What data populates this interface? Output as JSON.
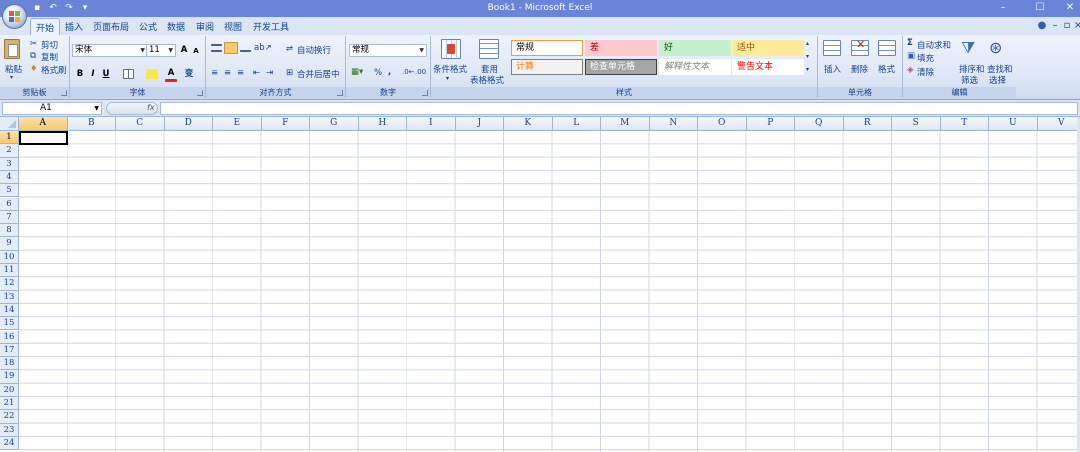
{
  "app": {
    "title": "Book1 - Microsoft Excel"
  },
  "qat": {
    "icons": [
      "save-icon",
      "undo-icon",
      "redo-icon",
      "customize-icon"
    ]
  },
  "tabs": [
    "开始",
    "插入",
    "页面布局",
    "公式",
    "数据",
    "审阅",
    "视图",
    "开发工具"
  ],
  "active_tab": "开始",
  "ribbon": {
    "clipboard": {
      "label": "剪贴板",
      "paste": "粘贴",
      "cut": "剪切",
      "copy": "复制",
      "format_painter": "格式刷"
    },
    "font": {
      "label": "字体",
      "font_name": "宋体",
      "font_size": "11",
      "bold": "B",
      "italic": "I",
      "underline": "U",
      "font_color_letter": "A",
      "phonetic": "变"
    },
    "alignment": {
      "label": "对齐方式",
      "wrap_text": "自动换行",
      "merge_center": "合并后居中"
    },
    "number": {
      "label": "数字",
      "format": "常规",
      "percent": "%",
      "comma": ","
    },
    "styles": {
      "label": "样式",
      "conditional_formatting": "条件格式",
      "format_as_table_1": "套用",
      "format_as_table_2": "表格格式",
      "cells": [
        {
          "text": "常规",
          "bg": "#ffffff",
          "color": "#000000",
          "border": "#e8a33d"
        },
        {
          "text": "差",
          "bg": "#ffc7ce",
          "color": "#9c0006",
          "border": "transparent"
        },
        {
          "text": "好",
          "bg": "#c6efce",
          "color": "#006100",
          "border": "transparent"
        },
        {
          "text": "适中",
          "bg": "#ffeb9c",
          "color": "#9c5700",
          "border": "transparent"
        },
        {
          "text": "计算",
          "bg": "#f2f2f2",
          "color": "#fa7d00",
          "border": "#7f7f7f"
        },
        {
          "text": "检查单元格",
          "bg": "#a5a5a5",
          "color": "#ffffff",
          "border": "#3f3f3f"
        },
        {
          "text": "解释性文本",
          "bg": "#ffffff",
          "color": "#7f7f7f",
          "border": "transparent"
        },
        {
          "text": "警告文本",
          "bg": "#ffffff",
          "color": "#ff0000",
          "border": "transparent"
        }
      ]
    },
    "cells": {
      "label": "单元格",
      "insert": "插入",
      "delete": "删除",
      "format": "格式"
    },
    "editing": {
      "label": "编辑",
      "autosum": "自动求和",
      "fill": "填充",
      "clear": "清除",
      "sort_filter_1": "排序和",
      "sort_filter_2": "筛选",
      "find_select_1": "查找和",
      "find_select_2": "选择"
    }
  },
  "formula_bar": {
    "name_box": "A1",
    "fx": "fx",
    "formula": ""
  },
  "sheet": {
    "columns": [
      "A",
      "B",
      "C",
      "D",
      "E",
      "F",
      "G",
      "H",
      "I",
      "J",
      "K",
      "L",
      "M",
      "N",
      "O",
      "P",
      "Q",
      "R",
      "S",
      "T",
      "U",
      "V"
    ],
    "rows": [
      "1",
      "2",
      "3",
      "4",
      "5",
      "6",
      "7",
      "8",
      "9",
      "10",
      "11",
      "12",
      "13",
      "14",
      "15",
      "16",
      "17",
      "18",
      "19",
      "20",
      "21",
      "22",
      "23",
      "24"
    ],
    "selected_cell": "A1"
  }
}
